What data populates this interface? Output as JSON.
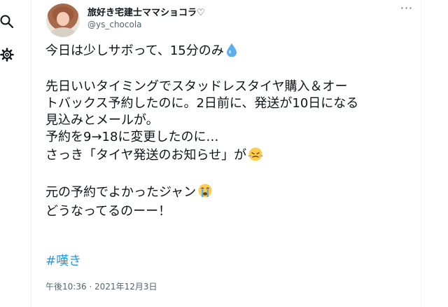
{
  "tweet": {
    "author": {
      "display_name": "旅好き宅建士ママショコラ♡",
      "handle": "@ys_chocola"
    },
    "more_label": "···",
    "lines": [
      "今日は少しサボって、15分のみ",
      "",
      "先日いいタイミングでスタッドレスタイヤ購入＆オー",
      "トバックス予約したのに。2日前に、発送が10日になる",
      "見込みとメールが。",
      "予約を9→18に変更したのに…",
      "さっき「タイヤ発送のお知らせ」が",
      "",
      "元の予約でよかったジャン",
      "どうなってるのーー！"
    ],
    "emojis": {
      "line0": "droplet-icon",
      "line6": "steaming-face-icon",
      "line8": "crying-face-icon"
    },
    "hashtag": "#嘆き",
    "timestamp": "午後10:36 · 2021年12月3日"
  },
  "left_nav": {
    "icons": [
      "search-icon",
      "gear-icon"
    ]
  },
  "colors": {
    "text": "#0f1419",
    "secondary": "#536471",
    "link": "#1d9bf0",
    "border": "#eff3f4"
  }
}
